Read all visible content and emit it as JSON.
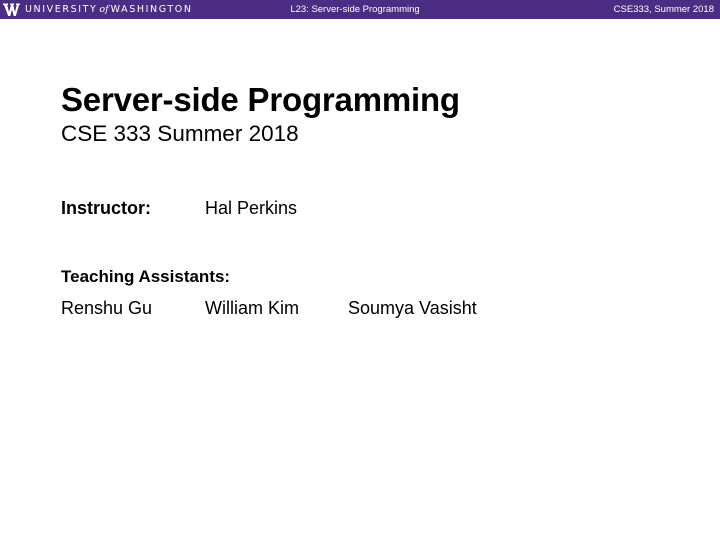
{
  "header": {
    "logo_wordmark_left": "UNIVERSITY",
    "logo_wordmark_of": "of",
    "logo_wordmark_right": "WASHINGTON",
    "lecture_title": "L23: Server-side Programming",
    "course_term": "CSE333, Summer 2018",
    "background_color": "#4b2e83",
    "logo_icon": "uw-w-icon"
  },
  "slide": {
    "title": "Server-side Programming",
    "subtitle": "CSE 333 Summer 2018",
    "instructor_label": "Instructor:",
    "instructor_name": "Hal Perkins",
    "ta_label": "Teaching Assistants:",
    "teaching_assistants": [
      "Renshu Gu",
      "William Kim",
      "Soumya Vasisht"
    ]
  }
}
